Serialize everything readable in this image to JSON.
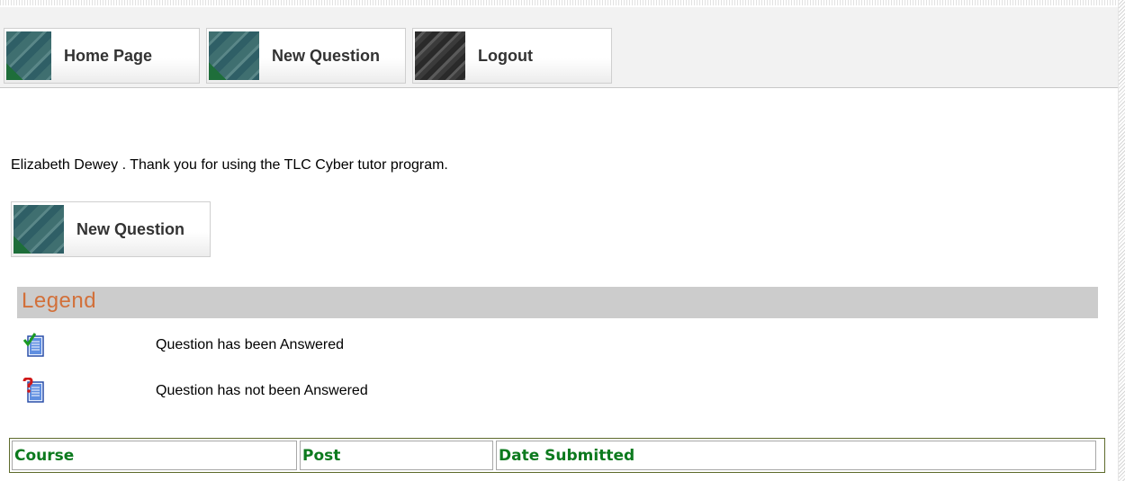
{
  "nav": {
    "items": [
      {
        "label": "Home Page"
      },
      {
        "label": "New Question"
      },
      {
        "label": "Logout"
      }
    ]
  },
  "main": {
    "thank_you": "Elizabeth Dewey .  Thank you for using the TLC Cyber tutor program.",
    "new_question_label": "New Question"
  },
  "legend": {
    "title": "Legend",
    "items": [
      {
        "icon": "answered-document-icon",
        "text": "Question has been Answered"
      },
      {
        "icon": "unanswered-document-icon",
        "text": "Question has not been Answered"
      }
    ]
  },
  "table": {
    "columns": [
      "Course",
      "Post",
      "Date Submitted"
    ]
  },
  "colors": {
    "legend_title": "#d2703a",
    "table_header_text": "#0c7a1e",
    "legend_bar": "#cccccc"
  }
}
